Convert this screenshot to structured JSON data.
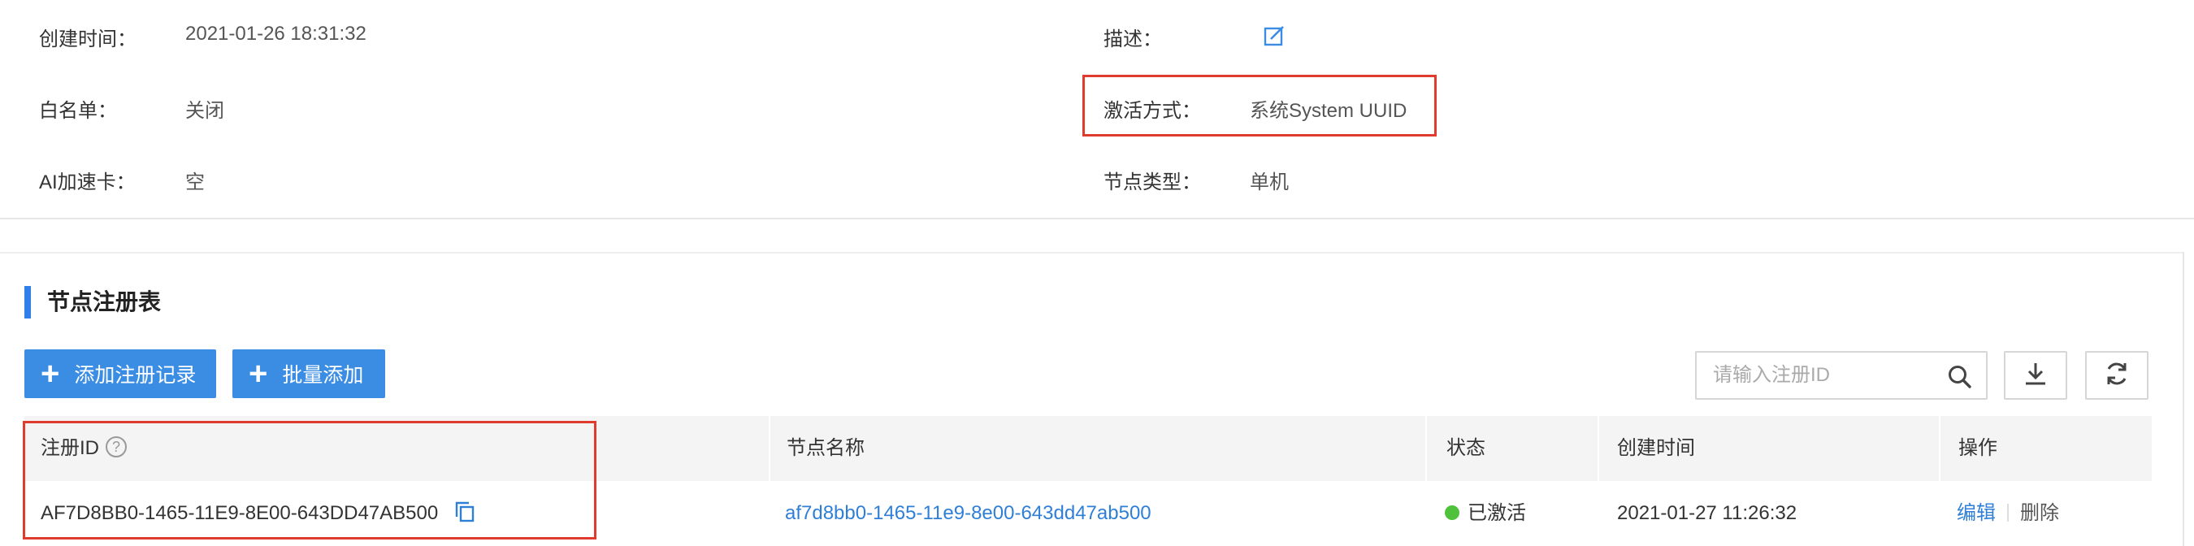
{
  "details": {
    "created_label": "创建时间：",
    "created_value": "2021-01-26 18:31:32",
    "desc_label": "描述：",
    "whitelist_label": "白名单：",
    "whitelist_value": "关闭",
    "activation_label": "激活方式：",
    "activation_value": "系统System UUID",
    "ai_card_label": "AI加速卡：",
    "ai_card_value": "空",
    "node_type_label": "节点类型：",
    "node_type_value": "单机"
  },
  "section": {
    "title": "节点注册表"
  },
  "toolbar": {
    "add_record_label": "添加注册记录",
    "batch_add_label": "批量添加"
  },
  "search": {
    "placeholder": "请输入注册ID"
  },
  "table": {
    "headers": [
      "注册ID",
      "节点名称",
      "状态",
      "创建时间",
      "操作"
    ],
    "help_glyph": "?",
    "rows": [
      {
        "reg_id": "AF7D8BB0-1465-11E9-8E00-643DD47AB500",
        "node_name": "af7d8bb0-1465-11e9-8e00-643dd47ab500",
        "status": "已激活",
        "created": "2021-01-27 11:26:32",
        "edit": "编辑",
        "delete": "删除"
      }
    ]
  },
  "colors": {
    "accent": "#3b8ce3",
    "highlight_border": "#e03b2f",
    "status_active": "#4fc13a",
    "link": "#2f7fd6"
  }
}
